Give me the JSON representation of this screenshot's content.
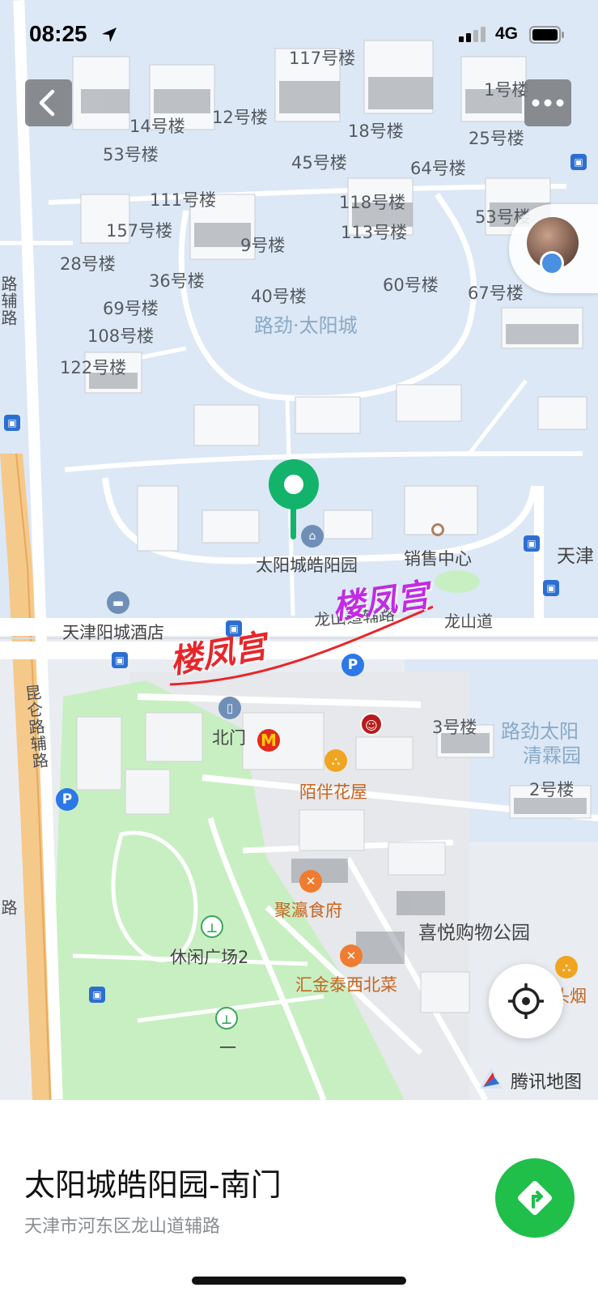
{
  "status_bar": {
    "time": "08:25",
    "network": "4G"
  },
  "map": {
    "building_labels": [
      "117号楼",
      "1号楼",
      "14号楼",
      "12号楼",
      "18号楼",
      "25号楼",
      "53号楼",
      "45号楼",
      "64号楼",
      "111号楼",
      "118号楼",
      "53号楼",
      "157号楼",
      "113号楼",
      "9号楼",
      "28号楼",
      "36号楼",
      "40号楼",
      "60号楼",
      "67号楼",
      "69号楼",
      "108号楼",
      "122号楼",
      "3号楼",
      "2号楼"
    ],
    "area_labels": {
      "complex": "路劲·太阳城",
      "complex2_line1": "路劲太阳",
      "complex2_line2": "清霖园"
    },
    "poi": {
      "destination": "太阳城皓阳园",
      "sales_center": "销售中心",
      "tianjin_partial": "天津",
      "hotel": "天津阳城酒店",
      "north_gate": "北门",
      "flower_shop": "陌伴花屋",
      "restaurant1": "聚瀛食府",
      "mall": "喜悦购物公园",
      "plaza": "休闲广场2",
      "restaurant2": "汇金泰西北菜",
      "tobacco_partial": "头烟",
      "plaza_sub": "一"
    },
    "roads": {
      "longshan": "龙山道",
      "longshan_aux": "龙山道辅路",
      "kunlun_aux": "昆仑路辅路",
      "left_edge_aux": "路辅路",
      "left_edge_road": "路"
    },
    "watermark": {
      "text1": "楼凤宫",
      "text2": "楼凤宫"
    },
    "provider": "腾讯地图",
    "colors": {
      "residential": "#dce8f5",
      "green": "#c8efc2",
      "road": "#ffffff",
      "highway": "#f5c98a",
      "pin": "#14b36b",
      "watermark_red": "#e8262a",
      "watermark_purple": "#c22be3"
    },
    "icons": {
      "back": "chevron-left-icon",
      "more": "more-dots-icon",
      "locate": "locate-crosshair-icon",
      "navigate": "navigate-turn-icon"
    }
  },
  "destination_card": {
    "name": "太阳城皓阳园-南门",
    "address": "天津市河东区龙山道辅路"
  }
}
